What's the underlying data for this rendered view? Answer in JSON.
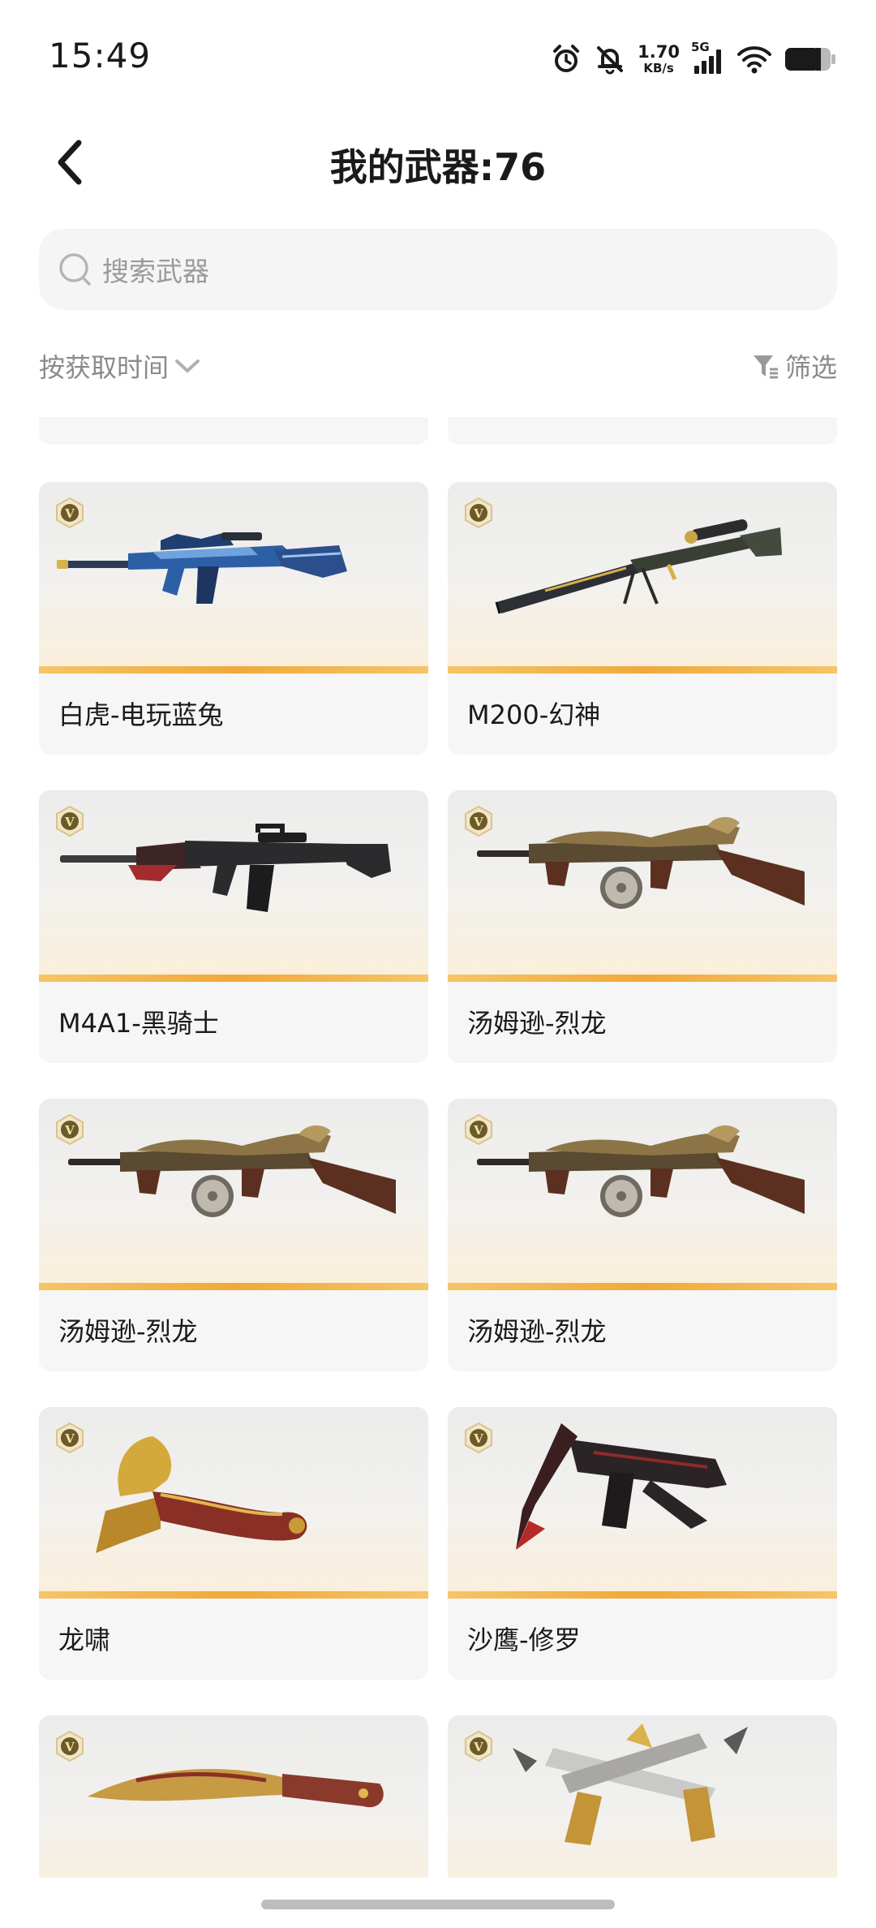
{
  "status_bar": {
    "time": "15:49",
    "net_speed_value": "1.70",
    "net_speed_unit": "KB/s",
    "network": "5G",
    "icons": [
      "alarm-icon",
      "mute-bell-icon",
      "signal-icon",
      "wifi-icon",
      "battery-icon"
    ]
  },
  "header": {
    "title": "我的武器:76",
    "back_icon": "chevron-left-icon"
  },
  "search": {
    "placeholder": "搜索武器"
  },
  "toolbar": {
    "sort_label": "按获取时间",
    "filter_label": "筛选"
  },
  "weapons": [
    {
      "name": "白虎-电玩蓝兔",
      "art": "rifle-blue"
    },
    {
      "name": "M200-幻神",
      "art": "sniper"
    },
    {
      "name": "M4A1-黑骑士",
      "art": "rifle-black"
    },
    {
      "name": "汤姆逊-烈龙",
      "art": "tommy"
    },
    {
      "name": "汤姆逊-烈龙",
      "art": "tommy"
    },
    {
      "name": "汤姆逊-烈龙",
      "art": "tommy"
    },
    {
      "name": "龙啸",
      "art": "axe"
    },
    {
      "name": "沙鹰-修罗",
      "art": "pistol"
    },
    {
      "name": "",
      "art": "knife"
    },
    {
      "name": "",
      "art": "dual-pistol"
    }
  ],
  "badge_letter": "V",
  "colors": {
    "accent_bar": "#f0a93a",
    "card_bg": "#f6f6f6",
    "muted_text": "#8a8a8a"
  }
}
